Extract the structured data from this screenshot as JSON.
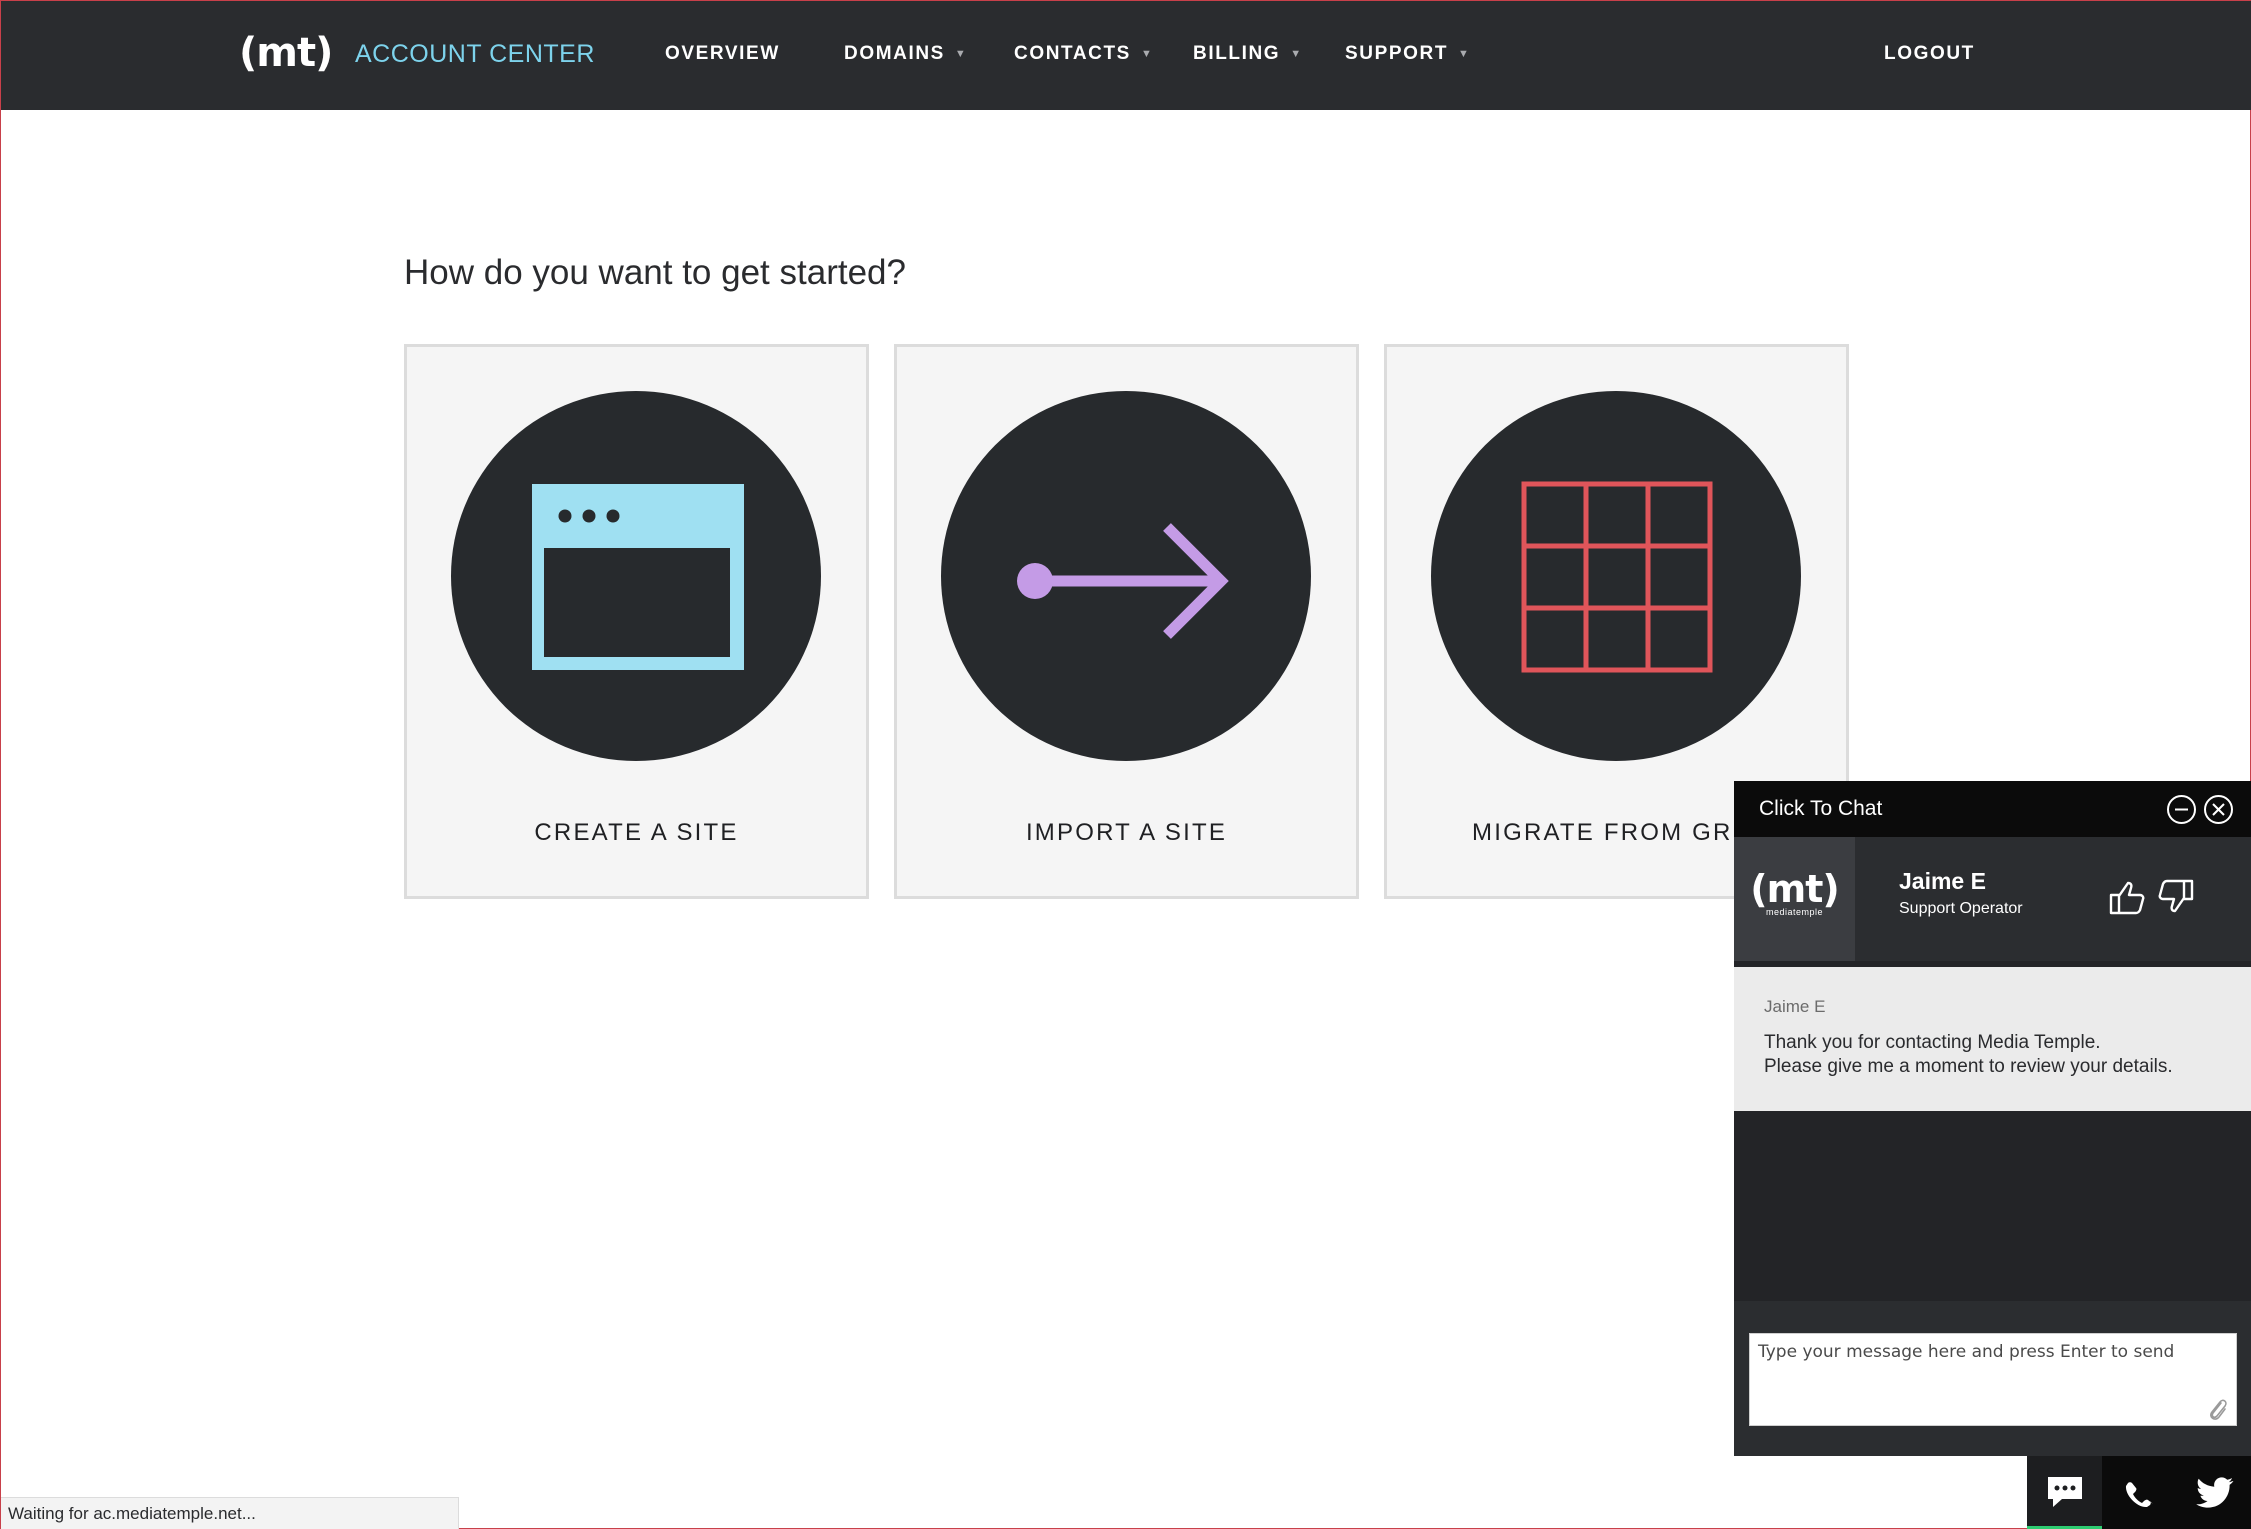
{
  "nav": {
    "logo": "(mt)",
    "brand": "ACCOUNT CENTER",
    "items": [
      {
        "label": "OVERVIEW",
        "caret": ""
      },
      {
        "label": "DOMAINS",
        "caret": "▼"
      },
      {
        "label": "CONTACTS",
        "caret": "▼"
      },
      {
        "label": "BILLING",
        "caret": "▼"
      },
      {
        "label": "SUPPORT",
        "caret": "▼"
      }
    ],
    "logout": "LOGOUT"
  },
  "main": {
    "heading": "How do you want to get started?",
    "cards": [
      {
        "label": "CREATE A SITE",
        "icon": "browser-window-icon",
        "color": "#9fe0f2"
      },
      {
        "label": "IMPORT A SITE",
        "icon": "arrow-right-icon",
        "color": "#c49be6"
      },
      {
        "label": "MIGRATE FROM GRID",
        "icon": "grid-icon",
        "color": "#e0555a"
      }
    ]
  },
  "chat": {
    "title": "Click To Chat",
    "minimize_icon": "minus-circle-icon",
    "close_icon": "close-circle-icon",
    "operator": {
      "logo": "(mt)",
      "logo_sub": "mediatemple",
      "name": "Jaime E",
      "role": "Support Operator"
    },
    "messages": [
      {
        "author": "Jaime E",
        "lines": [
          "Thank you for contacting Media Temple.",
          "Please give me a moment to review your details."
        ]
      }
    ],
    "input_placeholder": "Type your message here and press Enter to send",
    "tabs": [
      "chat-bubble-icon",
      "phone-icon",
      "twitter-icon"
    ],
    "accent": "#2ecc71"
  },
  "status": "Waiting for ac.mediatemple.net..."
}
